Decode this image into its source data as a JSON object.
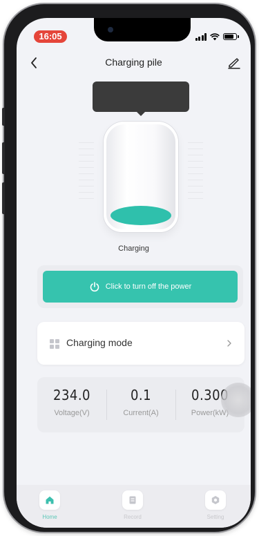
{
  "status_bar": {
    "time": "16:05"
  },
  "header": {
    "title": "Charging pile"
  },
  "pile": {
    "status": "Charging"
  },
  "power": {
    "label": "Click to turn off the power"
  },
  "mode": {
    "label": "Charging mode"
  },
  "stats": [
    {
      "value": "234.0",
      "label": "Voltage(V)"
    },
    {
      "value": "0.1",
      "label": "Current(A)"
    },
    {
      "value": "0.300",
      "label": "Power(kW)"
    }
  ],
  "tabs": [
    {
      "label": "Home",
      "icon": "home-icon",
      "active": true
    },
    {
      "label": "Record",
      "icon": "record-icon",
      "active": false
    },
    {
      "label": "Setting",
      "icon": "setting-icon",
      "active": false
    }
  ],
  "colors": {
    "accent": "#36c3ae",
    "time_pill": "#e5453a",
    "background": "#f2f3f7"
  }
}
